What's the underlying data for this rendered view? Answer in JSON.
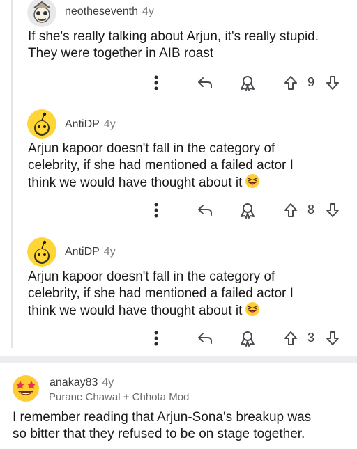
{
  "colors": {
    "thread_line": "#e5e5e7",
    "divider": "#ededef",
    "icon": "#4a4a4f",
    "text": "#1a1a1b",
    "meta": "#7c7c80"
  },
  "comments": [
    {
      "username": "neotheseventh",
      "age": "4y",
      "avatar_icon": "snoo-avatar-icon",
      "text": "If she's really talking about Arjun, it's really stupid.\nThey were together in AIB roast",
      "score": "9"
    },
    {
      "username": "AntiDP",
      "age": "4y",
      "avatar_icon": "snoo-default-avatar-icon",
      "text": "Arjun kapoor doesn't fall in the category of\ncelebrity,  if she had mentioned a failed actor I\nthink we would have thought about it",
      "emoji": "squinting-tongue-emoji",
      "score": "8"
    },
    {
      "username": "AntiDP",
      "age": "4y",
      "avatar_icon": "snoo-default-avatar-icon",
      "text": "Arjun kapoor doesn't fall in the category of\ncelebrity,  if she had mentioned a failed actor I\nthink we would have thought about it",
      "emoji": "squinting-tongue-emoji",
      "score": "3"
    },
    {
      "username": "anakay83",
      "age": "4y",
      "avatar_icon": "star-struck-avatar-icon",
      "flair": "Purane Chawal  +  Chhota Mod",
      "text": "I remember reading that Arjun-Sona's breakup was\nso bitter that they refused to be on stage together."
    }
  ]
}
